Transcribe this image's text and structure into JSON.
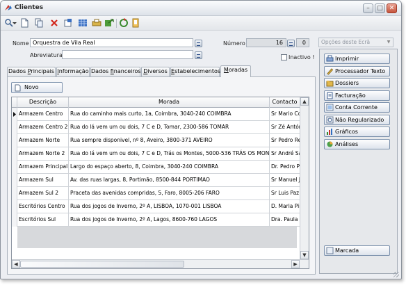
{
  "window": {
    "title": "Clientes",
    "minimize": "–",
    "maximize": "□",
    "close": "✕"
  },
  "toolbar": {
    "icons": [
      "search-icon",
      "dropdown-arrow-icon",
      "new-document-icon",
      "copy-icon",
      "delete-icon",
      "edit-icon",
      "table-icon",
      "print-icon",
      "export-icon",
      "refresh-icon",
      "book-icon"
    ]
  },
  "form": {
    "nome_label": "Nome",
    "nome_value": "Orquestra de Vila Real",
    "abreviatura_label": "Abreviatura",
    "abreviatura_value": "",
    "numero_label": "Número",
    "numero_value": "16",
    "numero_suffix": "0",
    "inactivo_label": "Inactivo !"
  },
  "options_combo": {
    "placeholder": "Opções deste Ecrã"
  },
  "tabs": [
    {
      "pre": "Dados ",
      "u": "P",
      "post": "rincipais"
    },
    {
      "pre": "",
      "u": "I",
      "post": "nformação"
    },
    {
      "pre": "Dados ",
      "u": "f",
      "post": "inanceiros"
    },
    {
      "pre": "",
      "u": "D",
      "post": "iversos"
    },
    {
      "pre": "",
      "u": "E",
      "post": "stabelecimentos"
    },
    {
      "pre": "",
      "u": "M",
      "post": "oradas"
    }
  ],
  "novo_button": "Novo",
  "grid": {
    "headers": [
      "Descrição",
      "Morada",
      "Contacto"
    ],
    "rows": [
      [
        "Armazem Centro",
        "Rua do caminho mais curto, 1a, Coimbra, 3040-240 COIMBRA",
        "Sr Mario Co"
      ],
      [
        "Armazem Centro 2",
        "Rua do lá vem um ou dois, 7 C e D, Tomar, 2300-586 TOMAR",
        "Sr Zé Antón"
      ],
      [
        "Armazem Norte",
        "Rua sempre disponivel, nº 8, Aveiro, 3800-371 AVEIRO",
        "Sr Pedro Re"
      ],
      [
        "Armazem Norte 2",
        "Rua do lá vem um ou dois, 7 C e D, Trás os Montes, 5000-536 TRÁS OS MONTES",
        "Sr André Sa"
      ],
      [
        "Armazem Principal",
        "Largo do espaço aberto, 8, Coimbra, 3040-240 COIMBRA",
        "Dr. Pedro P"
      ],
      [
        "Armazem Sul",
        "Av. das ruas largas, 8, Portimão, 8500-844 PORTIMAO",
        "Sr Manuel J"
      ],
      [
        "Armazem Sul 2",
        "Praceta das avenidas compridas, 5, Faro, 8005-206 FARO",
        "Sr Luis Paz"
      ],
      [
        "Escritórios Centro",
        "Rua dos jogos de Inverno, 2º A, LISBOA, 1070-001 LISBOA",
        "D. Maria Pir"
      ],
      [
        "Escritórios Sul",
        "Rua dos jogos de Inverno, 2º A, Lagos, 8600-760 LAGOS",
        "Dra. Paula S"
      ]
    ]
  },
  "side_buttons": [
    {
      "label": "Imprimir",
      "icon": "printer-icon"
    },
    {
      "label": "Processador Texto",
      "icon": "pencil-icon"
    },
    {
      "label": "Dossiers",
      "icon": "folder-icon"
    },
    {
      "label": "Facturação",
      "icon": "invoice-icon"
    },
    {
      "label": "Conta Corrente",
      "icon": "account-icon"
    },
    {
      "label": "Não Regularizado",
      "icon": "clock-icon"
    },
    {
      "label": "Gráficos",
      "icon": "chart-icon"
    },
    {
      "label": "Análises",
      "icon": "analysis-icon"
    }
  ],
  "marcada_button": "Marcada",
  "colors": {
    "accent": "#2f5fa8",
    "toolbar_bg": "#e9ecf0",
    "grid_empty": "#d7d9dc"
  }
}
